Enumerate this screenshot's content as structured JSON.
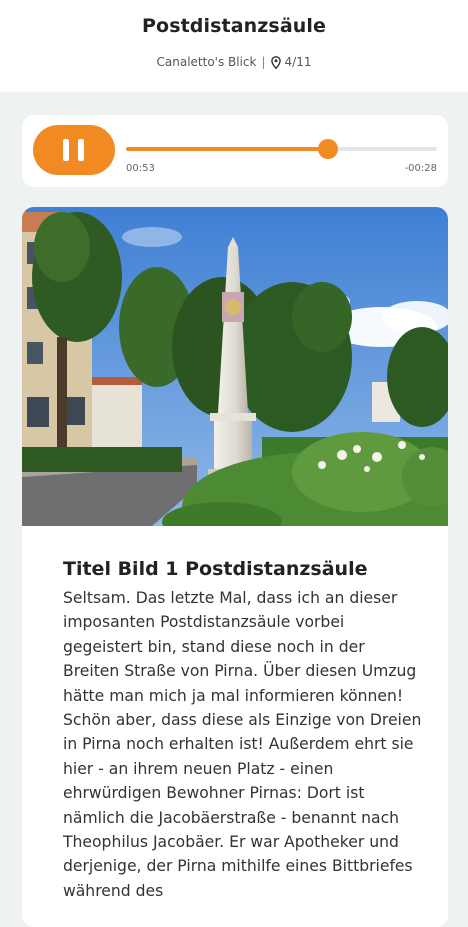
{
  "header": {
    "title": "Postdistanzsäule",
    "tour_name": "Canaletto's Blick",
    "separator": "|",
    "stop_position": "4/11"
  },
  "player": {
    "state": "playing",
    "elapsed": "00:53",
    "remaining": "-00:28",
    "progress": 0.65,
    "accent_color": "#f18a22"
  },
  "content": {
    "title": "Titel Bild 1 Postdistanzsäule",
    "body": "Seltsam. Das letzte Mal, dass ich an dieser imposanten Postdistanzsäule vorbei gegeistert bin, stand diese noch in der Breiten Straße von Pirna. Über diesen Umzug hätte man mich ja mal informieren können! Schön aber, dass diese als Einzige von Dreien in Pirna noch erhalten ist! Außerdem ehrt sie hier - an ihrem neuen Platz - einen ehrwürdigen Bewohner Pirnas: Dort ist nämlich die Jacobäerstraße - benannt nach Theophilus Jacobäer. Er war Apotheker und derjenige, der Pirna mithilfe eines Bittbriefes während des"
  }
}
